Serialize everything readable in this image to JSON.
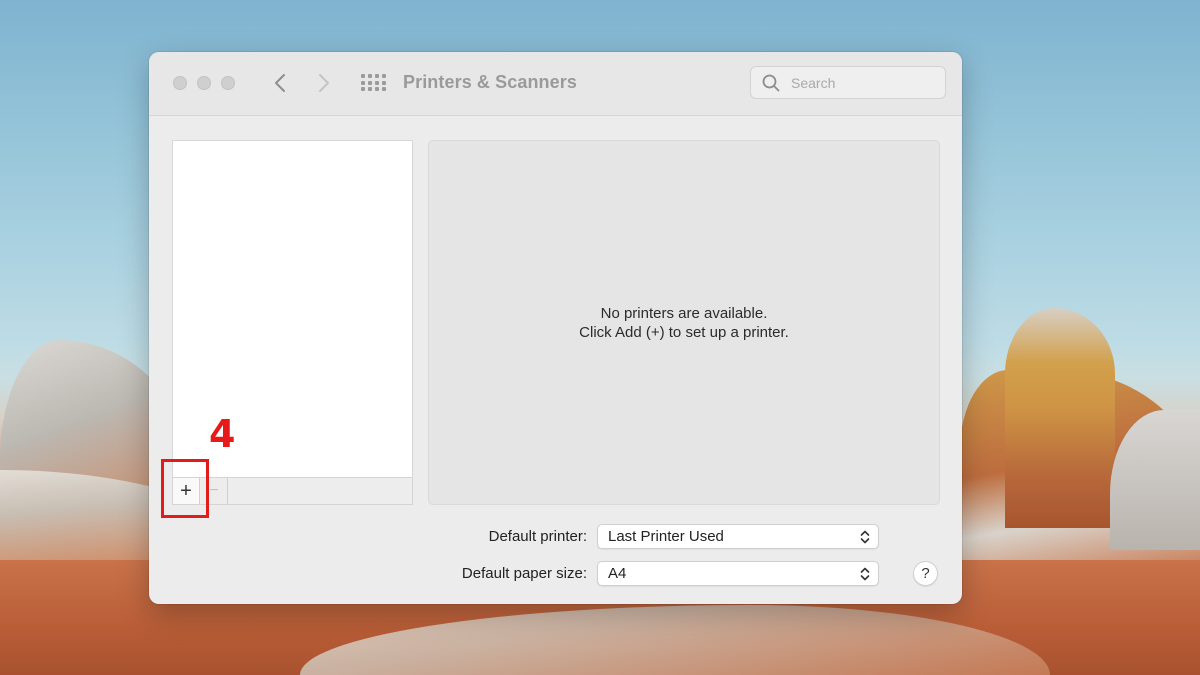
{
  "window": {
    "title": "Printers & Scanners"
  },
  "search": {
    "placeholder": "Search"
  },
  "printer_list": {
    "add_label": "+",
    "remove_label": "−"
  },
  "detail": {
    "line1": "No printers are available.",
    "line2": "Click Add (+) to set up a printer."
  },
  "settings": {
    "default_printer_label": "Default printer:",
    "default_printer_value": "Last Printer Used",
    "default_paper_label": "Default paper size:",
    "default_paper_value": "A4"
  },
  "help": {
    "label": "?"
  },
  "annotation": {
    "step": "4",
    "color": "#e21b1b"
  },
  "icons": [
    "back-chevron-icon",
    "forward-chevron-icon",
    "grid-icon",
    "search-icon",
    "popup-chevrons-icon"
  ]
}
